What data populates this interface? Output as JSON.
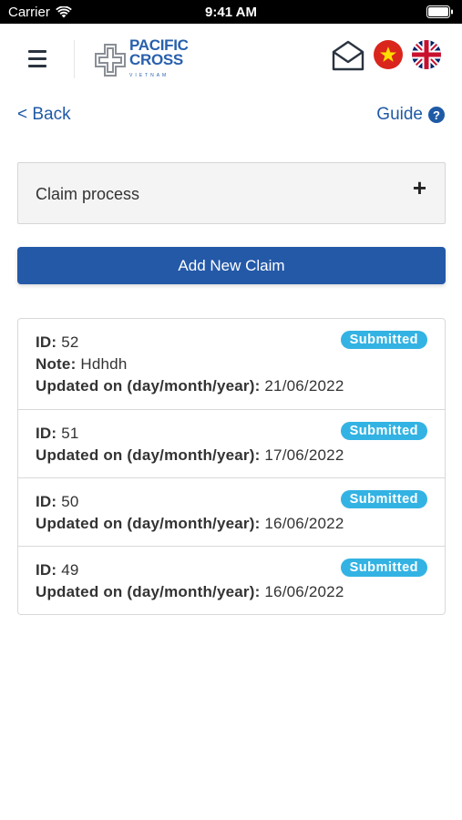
{
  "status_bar": {
    "carrier": "Carrier",
    "time": "9:41 AM"
  },
  "header": {
    "logo": {
      "line1": "PACIFIC",
      "line2": "CROSS",
      "sub": "VIETNAM"
    },
    "brand_color": "#2860ad"
  },
  "nav": {
    "back_label": "< Back",
    "guide_label": "Guide",
    "help_glyph": "?"
  },
  "accordion": {
    "label": "Claim process",
    "toggle_glyph": "+"
  },
  "add_claim_button": {
    "label": "Add New Claim",
    "color": "#2459a8"
  },
  "claims": {
    "labels": {
      "id": "ID:",
      "note": "Note:",
      "updated": "Updated on (day/month/year):"
    },
    "badge_color": "#33b3e3",
    "items": [
      {
        "id": "52",
        "note": "Hdhdh",
        "status": "Submitted",
        "updated": "21/06/2022"
      },
      {
        "id": "51",
        "status": "Submitted",
        "updated": "17/06/2022"
      },
      {
        "id": "50",
        "status": "Submitted",
        "updated": "16/06/2022"
      },
      {
        "id": "49",
        "status": "Submitted",
        "updated": "16/06/2022"
      }
    ]
  }
}
